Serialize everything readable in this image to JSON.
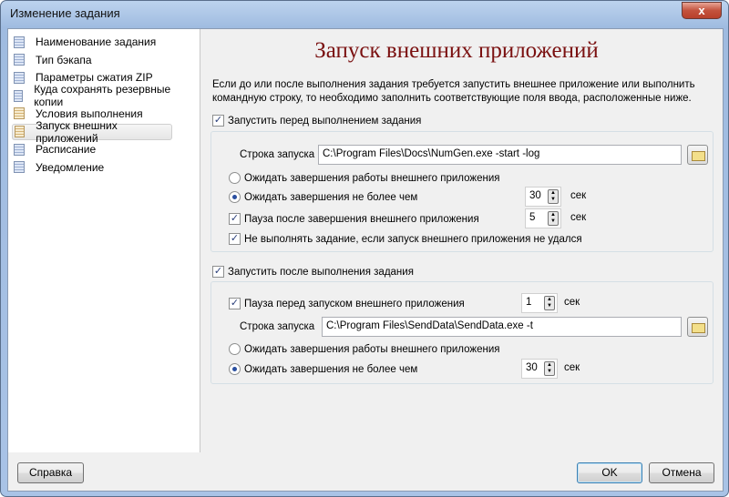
{
  "window": {
    "title": "Изменение задания",
    "close_glyph": "x"
  },
  "sidebar": {
    "items": [
      {
        "label": "Наименование задания",
        "icon": "page-blue",
        "selected": false
      },
      {
        "label": "Тип бэкапа",
        "icon": "page-blue",
        "selected": false
      },
      {
        "label": "Параметры сжатия ZIP",
        "icon": "page-blue",
        "selected": false
      },
      {
        "label": "Куда сохранять резервные копии",
        "icon": "page-blue",
        "selected": false
      },
      {
        "label": "Условия выполнения",
        "icon": "page-yellow",
        "selected": false
      },
      {
        "label": "Запуск внешних приложений",
        "icon": "page-yellow",
        "selected": true
      },
      {
        "label": "Расписание",
        "icon": "page-blue",
        "selected": false
      },
      {
        "label": "Уведомление",
        "icon": "page-blue",
        "selected": false
      }
    ]
  },
  "main": {
    "heading": "Запуск внешних приложений",
    "description": "Если до или после выполнения задания требуется запустить внешнее приложение или выполнить командную строку, то необходимо заполнить соответствующие поля ввода, расположенные ниже.",
    "before": {
      "enabled_label": "Запустить перед выполнением задания",
      "enabled": true,
      "cmd_label": "Строка запуска",
      "cmd_value": "C:\\Program Files\\Docs\\NumGen.exe -start -log",
      "wait_finish_label": "Ожидать завершения работы внешнего приложения",
      "wait_finish": false,
      "wait_max_label": "Ожидать завершения не более чем",
      "wait_max": true,
      "wait_max_value": "30",
      "wait_unit": "сек",
      "pause_label": "Пауза после завершения внешнего приложения",
      "pause": true,
      "pause_value": "5",
      "pause_unit": "сек",
      "skip_label": "Не выполнять задание, если запуск внешнего приложения не удался",
      "skip": true
    },
    "after": {
      "enabled_label": "Запустить после выполнения задания",
      "enabled": true,
      "pause_label": "Пауза перед запуском внешнего приложения",
      "pause": true,
      "pause_value": "1",
      "pause_unit": "сек",
      "cmd_label": "Строка запуска",
      "cmd_value": "C:\\Program Files\\SendData\\SendData.exe -t",
      "wait_finish_label": "Ожидать завершения работы внешнего приложения",
      "wait_finish": false,
      "wait_max_label": "Ожидать завершения не более чем",
      "wait_max": true,
      "wait_max_value": "30",
      "wait_unit": "сек"
    }
  },
  "footer": {
    "help": "Справка",
    "ok": "OK",
    "cancel": "Отмена"
  },
  "check_glyph": "✓"
}
